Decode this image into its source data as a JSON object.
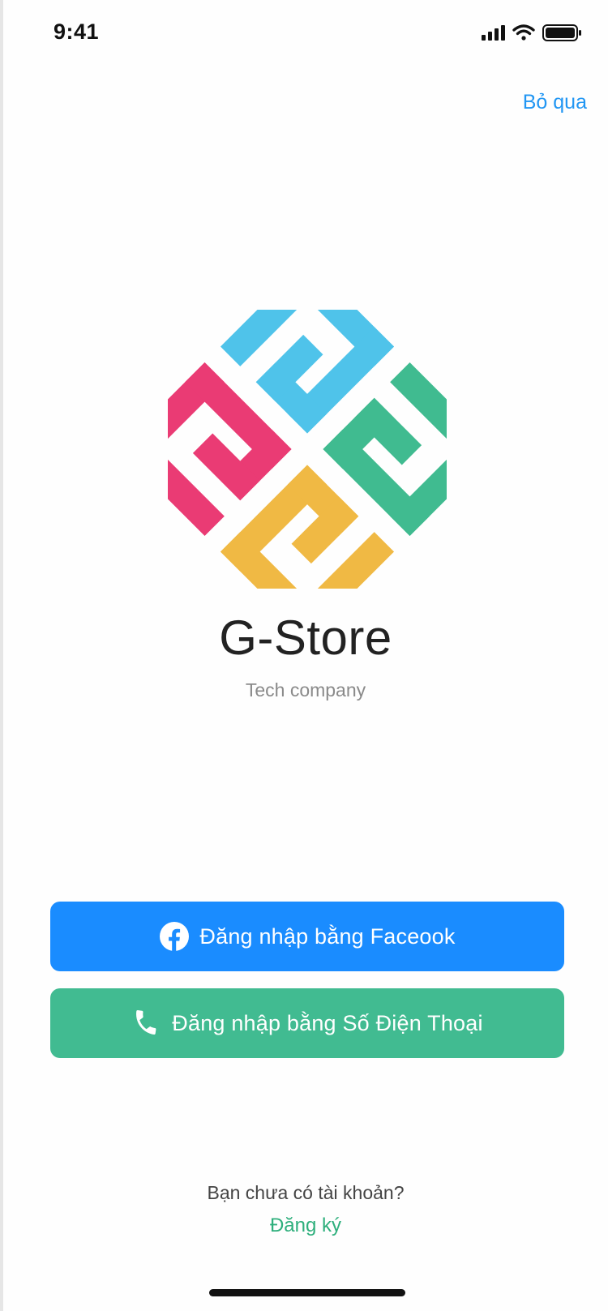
{
  "status_bar": {
    "time": "9:41",
    "icons": [
      "cellular-signal-icon",
      "wifi-icon",
      "battery-icon"
    ]
  },
  "header": {
    "skip_label": "Bỏ qua"
  },
  "brand": {
    "name": "G-Store",
    "tagline": "Tech company",
    "logo_colors": {
      "top": "#4fc3ea",
      "left": "#ea3b74",
      "right": "#40bb90",
      "bottom": "#f0b944"
    }
  },
  "login": {
    "facebook_label": "Đăng nhập bằng Faceook",
    "facebook_icon": "facebook-icon",
    "facebook_color": "#1a8cff",
    "phone_label": "Đăng nhập bằng Số Điện Thoại",
    "phone_icon": "phone-icon",
    "phone_color": "#41bb91"
  },
  "footer": {
    "no_account_text": "Bạn chưa có tài khoản?",
    "register_label": "Đăng ký"
  }
}
